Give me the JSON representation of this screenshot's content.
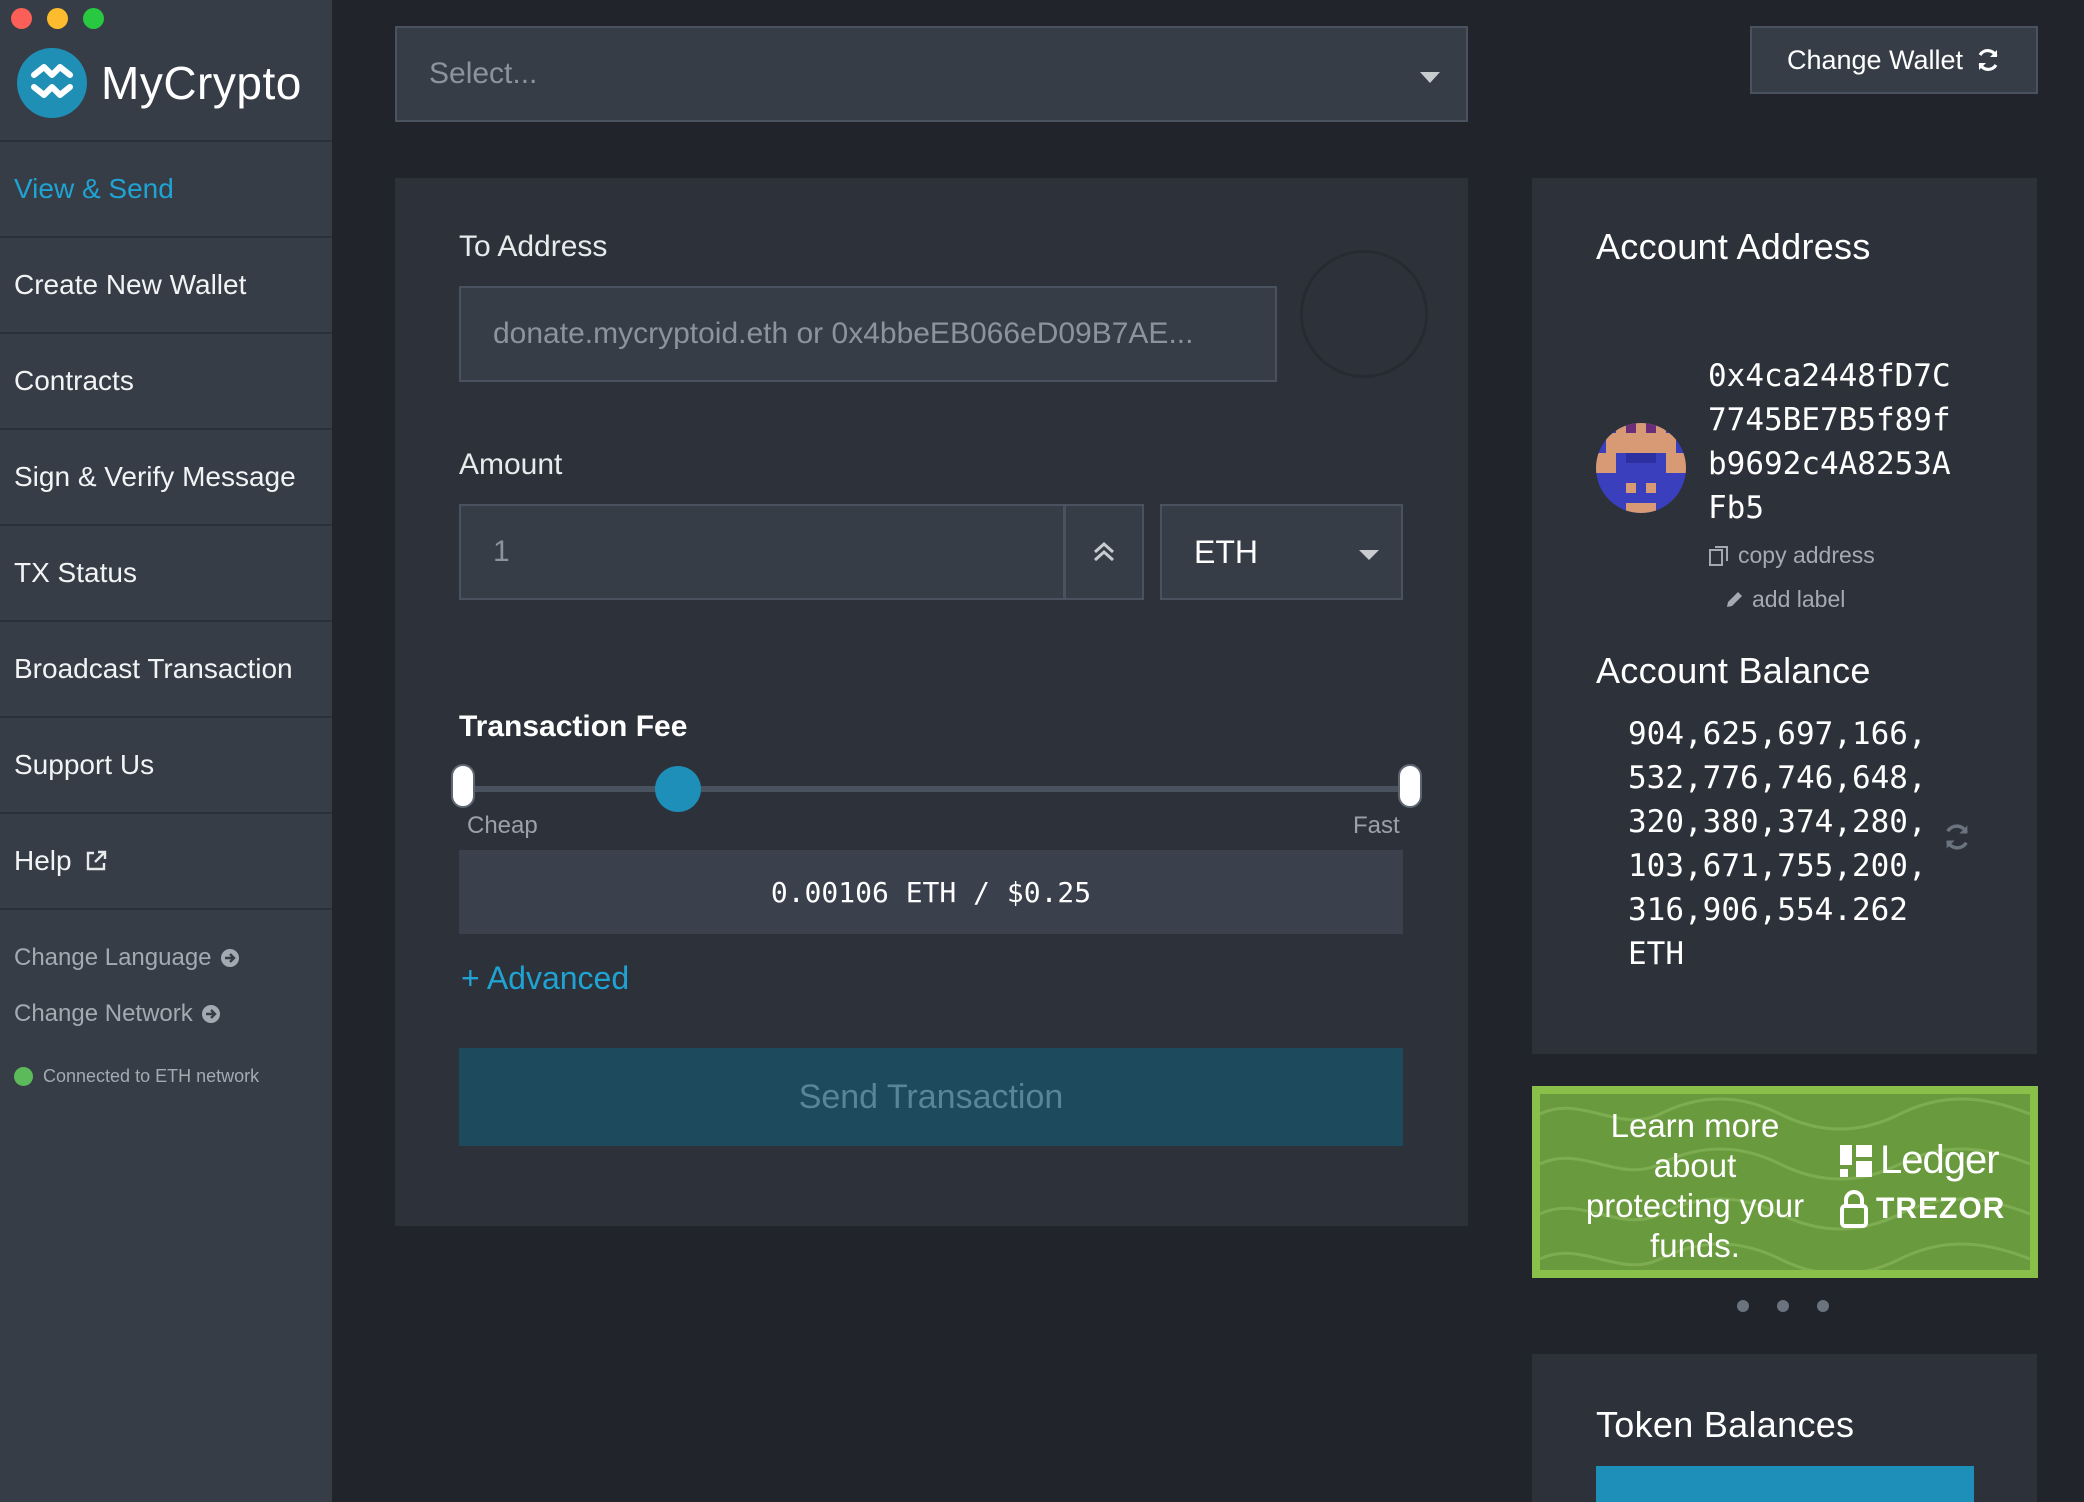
{
  "window": {
    "controls": [
      "close",
      "minimize",
      "maximize"
    ]
  },
  "brand": {
    "name": "MyCrypto",
    "logo_icon": "mycrypto-logo-icon"
  },
  "sidebar": {
    "items": [
      {
        "label": "View & Send",
        "active": true
      },
      {
        "label": "Create New Wallet",
        "active": false
      },
      {
        "label": "Contracts",
        "active": false
      },
      {
        "label": "Sign & Verify Message",
        "active": false
      },
      {
        "label": "TX Status",
        "active": false
      },
      {
        "label": "Broadcast Transaction",
        "active": false
      },
      {
        "label": "Support Us",
        "active": false
      },
      {
        "label": "Help",
        "active": false,
        "icon": "external-link-icon"
      }
    ],
    "change_language": "Change Language",
    "change_network": "Change Network",
    "status": "Connected to ETH network",
    "status_color": "#5dba5a"
  },
  "wallet_select": {
    "placeholder": "Select..."
  },
  "change_wallet": {
    "label": "Change Wallet",
    "icon": "refresh-icon"
  },
  "send_form": {
    "to_label": "To Address",
    "to_placeholder": "donate.mycryptoid.eth or 0x4bbeEB066eD09B7AE...",
    "amount_label": "Amount",
    "amount_value": "1",
    "unit": "ETH",
    "fee_label": "Transaction Fee",
    "fee_cheap": "Cheap",
    "fee_fast": "Fast",
    "fee_level": 0.23,
    "fee_display": "0.00106 ETH / $0.25",
    "advanced_label": "+ Advanced",
    "send_label": "Send Transaction"
  },
  "account": {
    "address_title": "Account Address",
    "address": "0x4ca2448fD7C7745BE7B5f89fb9692c4A8253AFb5",
    "copy_label": "copy address",
    "add_label": "add label",
    "balance_title": "Account Balance",
    "balance": "904,625,697,166,532,776,746,648,320,380,374,280,103,671,755,200,316,906,554.262 ETH"
  },
  "promo": {
    "text": "Learn more about protecting your funds.",
    "ledger": "Ledger",
    "trezor": "TREZOR",
    "slides": 3
  },
  "tokens": {
    "title": "Token Balances"
  },
  "colors": {
    "accent": "#1fa3d3",
    "sidebar_bg": "#363d47",
    "page_bg": "#21252b",
    "card_bg": "#2d323a",
    "promo_green": "#6a9a3e"
  }
}
